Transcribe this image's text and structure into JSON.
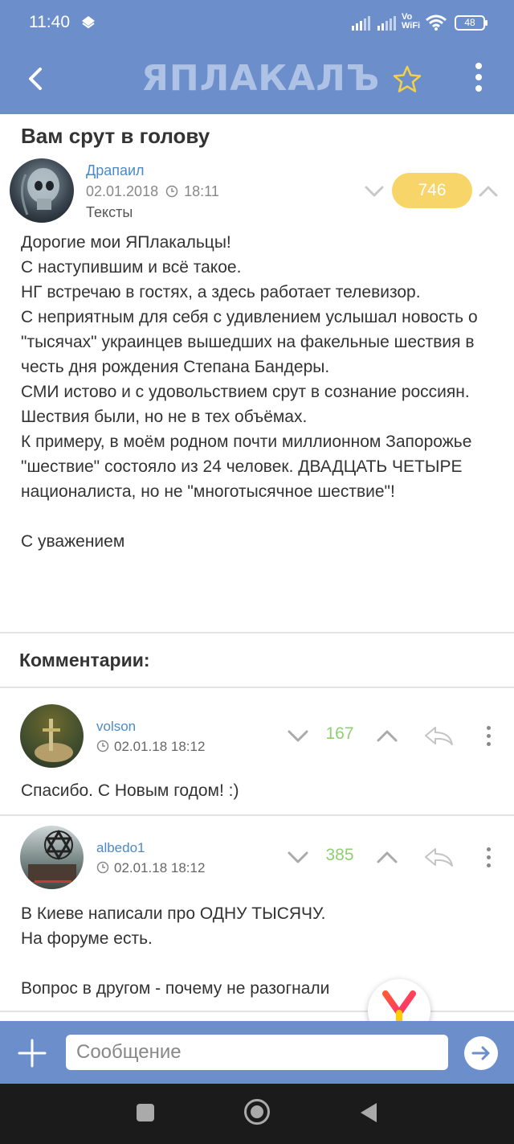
{
  "status_bar": {
    "time": "11:40",
    "vowifi_line1": "Vo",
    "vowifi_line2": "WiFi",
    "battery": "48"
  },
  "app_bar": {
    "logo_text": "ЯПЛАКАЛЪ",
    "back_icon": "chevron-left-icon",
    "favorite_icon": "star-outline-icon",
    "menu_icon": "more-vertical-icon"
  },
  "post": {
    "title": "Вам срут в голову",
    "author": "Драпаил",
    "date": "02.01.2018",
    "time": "18:11",
    "section": "Тексты",
    "rating": "746",
    "body": "Дорогие мои ЯПлакальцы!\nС наступившим и всё такое.\nНГ встречаю в гостях, а здесь работает телевизор.\nС неприятным для себя с удивлением услышал новость о \"тысячах\" украинцев вышедших на факельные шествия в честь дня рождения Степана Бандеры.\nСМИ истово и с удовольствием срут в сознание россиян.\nШествия были, но не в тех объёмах.\nК примеру, в моём родном почти миллионном Запорожье \"шествие\" состояло из 24 человек. ДВАДЦАТЬ ЧЕТЫРЕ националиста, но не \"многотысячное шествие\"!\n\nС уважением"
  },
  "comments_heading": "Комментарии:",
  "comments": [
    {
      "user": "volson",
      "datetime": "02.01.18 18:12",
      "rating": "167",
      "text": "Спасибо. С Новым годом! :)"
    },
    {
      "user": "albedo1",
      "datetime": "02.01.18 18:12",
      "rating": "385",
      "text": "В Киеве написали про ОДНУ ТЫСЯЧУ.\nНа форуме есть.\n\nВопрос в другом - почему не разогнали"
    }
  ],
  "composer": {
    "placeholder": "Сообщение"
  },
  "colors": {
    "header": "#6c8fcc",
    "rating_badge": "#f7d568",
    "positive_rating": "#8fcf74",
    "link": "#4b8ac6"
  }
}
